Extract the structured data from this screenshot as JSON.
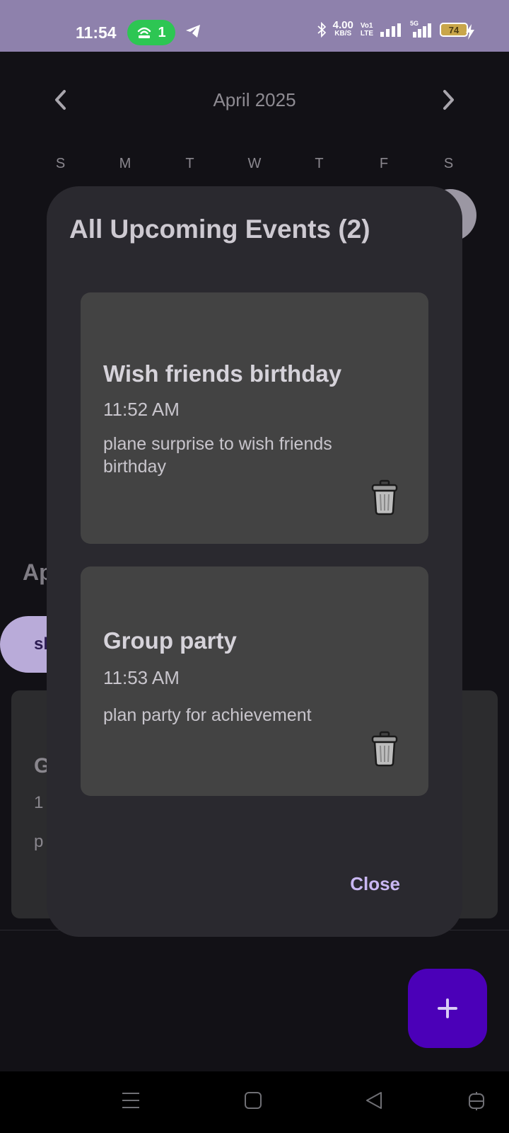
{
  "status_bar": {
    "time": "11:54",
    "hotspot_count": "1",
    "net_speed": "4.00",
    "net_speed_unit": "KB/S",
    "volte_top": "Vo",
    "volte_bottom": "LTE",
    "volte_sim": "1",
    "signal2_label": "5G",
    "battery": "74",
    "colors": {
      "bar": "#8e81ac",
      "hotspot": "#2dc653",
      "battery": "#c9a64a"
    }
  },
  "calendar": {
    "month_title": "April 2025",
    "weekdays": [
      "S",
      "M",
      "T",
      "W",
      "T",
      "F",
      "S"
    ]
  },
  "background": {
    "month_label_partial": "Ap",
    "chip_partial": "sl",
    "card_title_partial": "G",
    "card_time_partial": "1",
    "card_desc_partial": "p"
  },
  "dialog": {
    "title": "All Upcoming Events (2)",
    "events": [
      {
        "title": "Wish friends birthday",
        "time": "11:52 AM",
        "description": "plane surprise to wish friends birthday",
        "delete_icon": "trash-icon"
      },
      {
        "title": "Group party",
        "time": "11:53 AM",
        "description": "plan party for achievement",
        "delete_icon": "trash-icon"
      }
    ],
    "close_label": "Close"
  },
  "fab": {
    "icon": "plus-icon",
    "color": "#4b00b8"
  },
  "nav": {
    "icons": [
      "menu-icon",
      "home-icon",
      "back-icon",
      "accessibility-icon"
    ]
  }
}
